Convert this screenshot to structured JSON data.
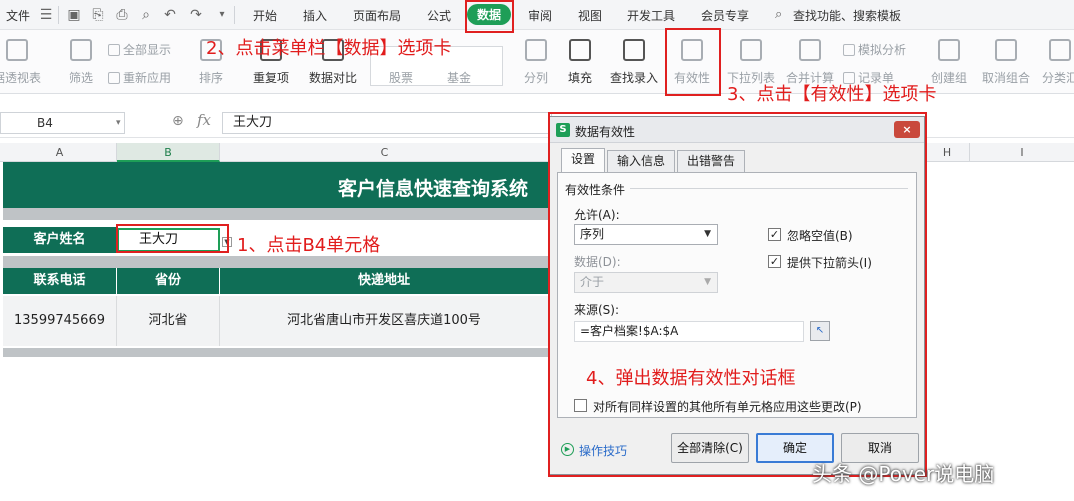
{
  "menu": {
    "file": "文件",
    "tabs": [
      "开始",
      "插入",
      "页面布局",
      "公式",
      "数据",
      "审阅",
      "视图",
      "开发工具",
      "会员专享"
    ],
    "active_tab": "数据",
    "search": "查找功能、搜索模板"
  },
  "ribbon": {
    "pivot": "据透视表",
    "filter": "筛选",
    "show_all": "全部显示",
    "reapply": "重新应用",
    "sort": "排序",
    "duplicates": "重复项",
    "compare": "数据对比",
    "stock": "股票",
    "fund": "基金",
    "split": "分列",
    "fill": "填充",
    "lookup": "查找录入",
    "validation": "有效性",
    "dropdown": "下拉列表",
    "consolidate": "合并计算",
    "whatif": "模拟分析",
    "record": "记录单",
    "group": "创建组",
    "ungroup": "取消组合",
    "subtotal": "分类汇"
  },
  "formula_bar": {
    "name_box": "B4",
    "fx": "fx",
    "value": "王大刀"
  },
  "sheet": {
    "columns": [
      "A",
      "B",
      "C",
      "H",
      "I"
    ],
    "title": "客户信息快速查询系统",
    "name_label": "客户姓名",
    "name_value": "王大刀",
    "headers": [
      "联系电话",
      "省份",
      "快递地址"
    ],
    "row": [
      "13599745669",
      "河北省",
      "河北省唐山市开发区喜庆道100号"
    ]
  },
  "dialog": {
    "title": "数据有效性",
    "close": "×",
    "tabs": [
      "设置",
      "输入信息",
      "出错警告"
    ],
    "group_label": "有效性条件",
    "allow_label": "允许(A):",
    "allow_value": "序列",
    "data_label": "数据(D):",
    "data_value": "介于",
    "ignore_blank": "忽略空值(B)",
    "show_dropdown": "提供下拉箭头(I)",
    "source_label": "来源(S):",
    "source_value": "=客户档案!$A:$A",
    "apply_all": "对所有同样设置的其他所有单元格应用这些更改(P)",
    "tips": "操作技巧",
    "clear_all": "全部清除(C)",
    "ok": "确定",
    "cancel": "取消"
  },
  "annotations": {
    "step1": "1、点击B4单元格",
    "step2": "2、点击菜单栏【数据】选项卡",
    "step3": "3、点击【有效性】选项卡",
    "step4": "4、弹出数据有效性对话框"
  },
  "watermark": "头条 @Pover说电脑",
  "colors": {
    "accent_green": "#1e9e57",
    "sheet_green": "#0f6e56",
    "annotation_red": "#e02020"
  }
}
